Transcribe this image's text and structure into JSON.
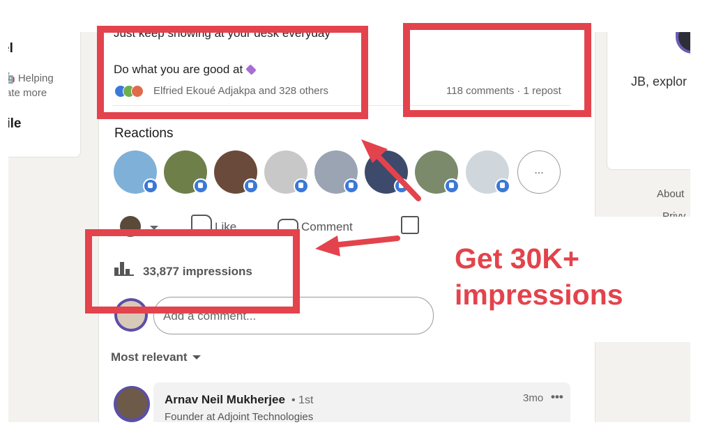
{
  "left_panel": {
    "title_fragment": "el",
    "line1": "🤖 Helping",
    "line2": "rate more",
    "profile_fragment": "file"
  },
  "right_panel": {
    "name_fragment": "JB, explor",
    "about": "About",
    "privacy_fragment": "Privy"
  },
  "post": {
    "line1": "Just keep showing at your desk everyday",
    "line2": "Do what you are good at",
    "reactors_text": "Elfried Ekoué Adjakpa and 328 others",
    "counts_text": "118 comments · 1 repost",
    "reactions_title": "Reactions",
    "more_reactors": "...",
    "actions": {
      "like": "Like",
      "comment": "Comment"
    },
    "impressions": "33,877 impressions",
    "comment_placeholder": "Add a comment...",
    "sort_label": "Most relevant"
  },
  "comment": {
    "name": "Arnav Neil Mukherjee",
    "degree": "• 1st",
    "headline": "Founder at Adjoint Technologies",
    "time": "3mo",
    "more": "•••"
  },
  "callout": {
    "line1": "Get 30K+",
    "line2": "impressions"
  },
  "colors": {
    "highlight": "#e3434c",
    "like_blue": "#3b78d7"
  }
}
